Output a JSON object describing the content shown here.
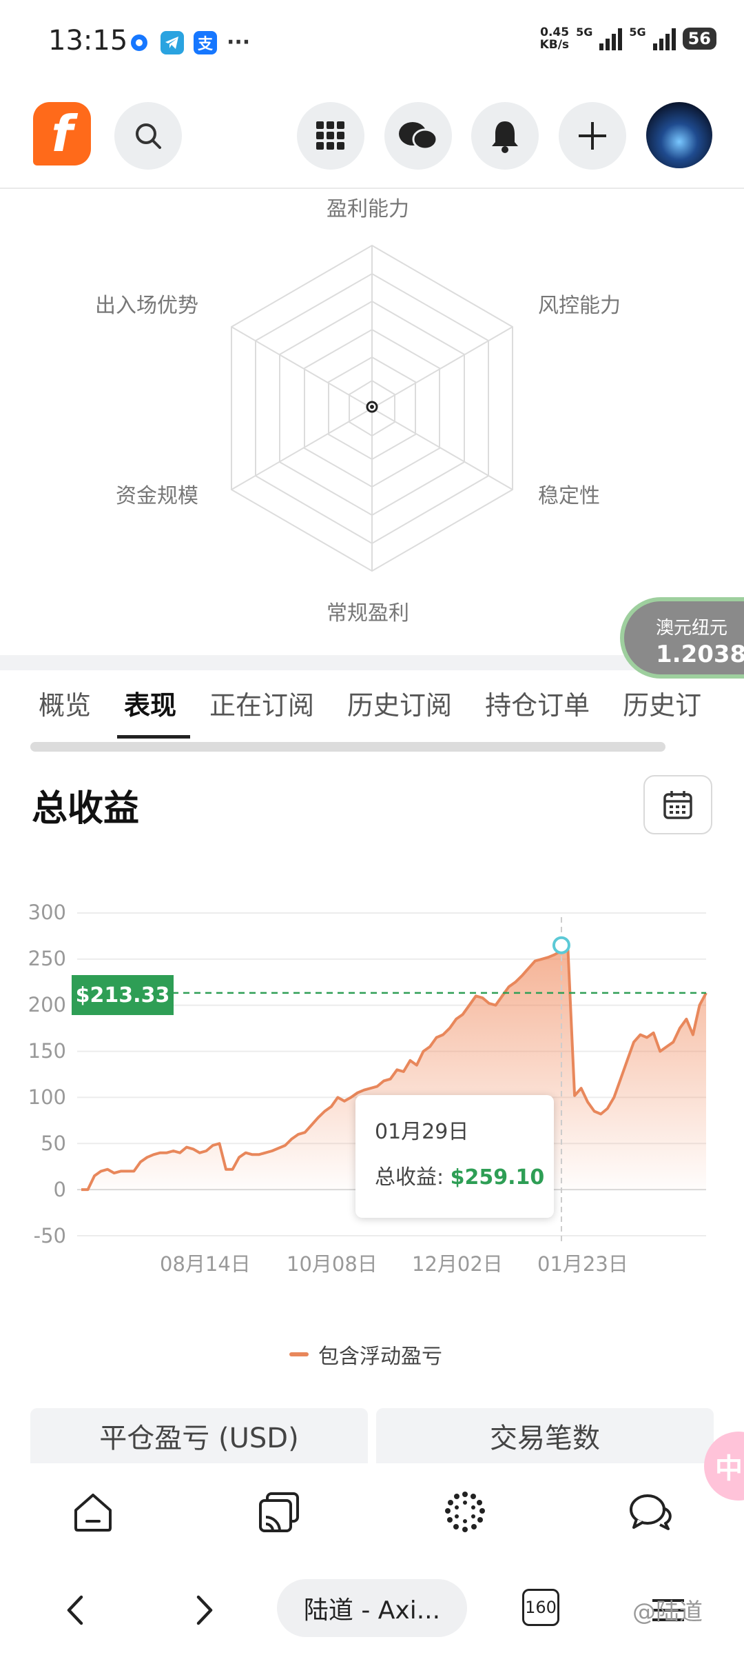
{
  "status_bar": {
    "time": "13:15",
    "app_icons": [
      "record-icon",
      "telegram-icon",
      "alipay-icon"
    ],
    "more": "···",
    "net_speed_value": "0.45",
    "net_speed_unit": "KB/s",
    "sim1_label": "5G",
    "sim2_label": "5G",
    "battery": "56"
  },
  "header": {
    "logo_letter": "f",
    "icons": [
      "search-icon",
      "apps-grid-icon",
      "chat-icon",
      "bell-icon",
      "plus-icon"
    ]
  },
  "radar": {
    "labels": {
      "top": "盈利能力",
      "top_right": "风控能力",
      "bottom_right": "稳定性",
      "bottom": "常规盈利",
      "bottom_left": "资金规模",
      "top_left": "出入场优势"
    }
  },
  "currency_pill": {
    "name": "澳元纽元",
    "value": "1.2038"
  },
  "tabs": [
    {
      "label": "概览",
      "active": false
    },
    {
      "label": "表现",
      "active": true
    },
    {
      "label": "正在订阅",
      "active": false
    },
    {
      "label": "历史订阅",
      "active": false
    },
    {
      "label": "持仓订单",
      "active": false
    },
    {
      "label": "历史订",
      "active": false
    }
  ],
  "section": {
    "title": "总收益"
  },
  "chart_data": {
    "type": "area",
    "yticks": [
      "300",
      "250",
      "200",
      "150",
      "100",
      "50",
      "0",
      "-50"
    ],
    "ylim": [
      -50,
      300
    ],
    "xticks": [
      "08月14日",
      "10月08日",
      "12月02日",
      "01月23日"
    ],
    "current_value_label": "$213.33",
    "current_value": 213.33,
    "tooltip": {
      "date": "01月29日",
      "label": "总收益:",
      "value": "$259.10",
      "value_num": 259.1
    },
    "legend": "包含浮动盈亏",
    "series": [
      {
        "name": "包含浮动盈亏",
        "color": "#e8875b",
        "values": [
          0,
          0,
          15,
          20,
          22,
          18,
          20,
          20,
          20,
          30,
          35,
          38,
          40,
          40,
          42,
          40,
          46,
          44,
          40,
          42,
          48,
          50,
          22,
          22,
          35,
          40,
          38,
          38,
          40,
          42,
          45,
          48,
          55,
          60,
          62,
          70,
          78,
          85,
          90,
          100,
          96,
          100,
          105,
          108,
          110,
          112,
          118,
          120,
          130,
          128,
          140,
          135,
          150,
          155,
          165,
          168,
          175,
          185,
          190,
          200,
          210,
          208,
          202,
          200,
          210,
          220,
          225,
          232,
          240,
          248,
          250,
          252,
          255,
          259.1,
          260,
          102,
          110,
          95,
          85,
          82,
          88,
          100,
          120,
          140,
          160,
          168,
          165,
          170,
          150,
          155,
          160,
          175,
          185,
          168,
          200,
          213.33
        ]
      }
    ]
  },
  "cards": [
    "平仓盈亏 (USD)",
    "交易笔数"
  ],
  "float_badge": "中",
  "bottom_nav": {
    "icons": [
      "home-icon",
      "cast-icon",
      "community-icon",
      "messages-icon"
    ]
  },
  "browser": {
    "url_title": "陆道 - Axi...",
    "tab_count": "160",
    "watermark": "@陆道"
  }
}
